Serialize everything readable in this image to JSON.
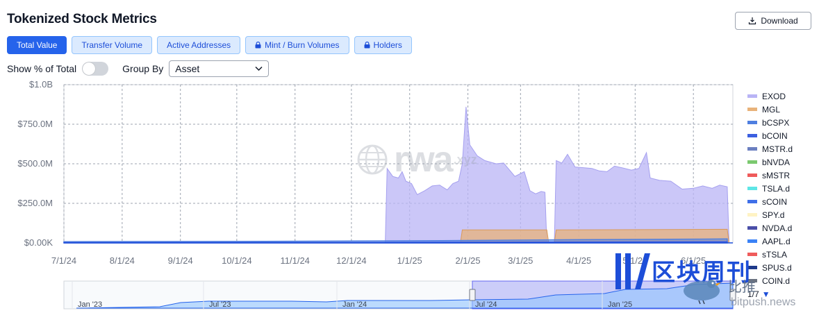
{
  "header": {
    "title": "Tokenized Stock Metrics",
    "download_label": "Download"
  },
  "tabs": [
    {
      "label": "Total Value",
      "active": true,
      "locked": false
    },
    {
      "label": "Transfer Volume",
      "active": false,
      "locked": false
    },
    {
      "label": "Active Addresses",
      "active": false,
      "locked": false
    },
    {
      "label": "Mint / Burn Volumes",
      "active": false,
      "locked": true
    },
    {
      "label": "Holders",
      "active": false,
      "locked": true
    }
  ],
  "controls": {
    "show_pct_label": "Show % of Total",
    "show_pct_enabled": false,
    "group_by_label": "Group By",
    "group_by_value": "Asset"
  },
  "legend": {
    "items": [
      {
        "name": "EXOD",
        "color": "#b9b4f5"
      },
      {
        "name": "MGL",
        "color": "#e8b27a"
      },
      {
        "name": "bCSPX",
        "color": "#4f7fe0"
      },
      {
        "name": "bCOIN",
        "color": "#3b5fe0"
      },
      {
        "name": "MSTR.d",
        "color": "#6b7fc0"
      },
      {
        "name": "bNVDA",
        "color": "#7bc96f"
      },
      {
        "name": "sMSTR",
        "color": "#ef5b5b"
      },
      {
        "name": "TSLA.d",
        "color": "#5ee6e6"
      },
      {
        "name": "sCOIN",
        "color": "#3f6fe8"
      },
      {
        "name": "SPY.d",
        "color": "#fff3c4"
      },
      {
        "name": "NVDA.d",
        "color": "#4a4fa8"
      },
      {
        "name": "AAPL.d",
        "color": "#3b82f6"
      },
      {
        "name": "sTSLA",
        "color": "#ef5b5b"
      },
      {
        "name": "SPUS.d",
        "color": "#1e3a8a"
      },
      {
        "name": "COIN.d",
        "color": "#6b7280"
      }
    ],
    "page": "1/7"
  },
  "watermark": {
    "logo_text": "rwa",
    "logo_suffix": ".xyz",
    "brand_cn": "区块周刊",
    "brand_cn_sub": "比推",
    "brand_url": "bitpush.news"
  },
  "chart_data": {
    "type": "area",
    "title": "",
    "xlabel": "",
    "ylabel": "",
    "ylim": [
      0,
      1000000000
    ],
    "y_ticks": [
      "$0.00K",
      "$250.0M",
      "$500.0M",
      "$750.0M",
      "$1.0B"
    ],
    "x_ticks": [
      "7/1/24",
      "8/1/24",
      "9/1/24",
      "10/1/24",
      "11/1/24",
      "12/1/24",
      "1/1/25",
      "2/1/25",
      "3/1/25",
      "4/1/25",
      "5/1/25",
      "6/1/25"
    ],
    "x_range": [
      "2024-07-01",
      "2025-06-22"
    ],
    "grid": true,
    "legend_position": "right",
    "series": [
      {
        "name": "EXOD",
        "color": "#b9b4f5",
        "points": [
          [
            "2024-12-19",
            0
          ],
          [
            "2024-12-20",
            470000000
          ],
          [
            "2024-12-23",
            420000000
          ],
          [
            "2024-12-26",
            410000000
          ],
          [
            "2024-12-28",
            450000000
          ],
          [
            "2024-12-30",
            390000000
          ],
          [
            "2025-01-02",
            375000000
          ],
          [
            "2025-01-05",
            305000000
          ],
          [
            "2025-01-09",
            330000000
          ],
          [
            "2025-01-13",
            360000000
          ],
          [
            "2025-01-17",
            365000000
          ],
          [
            "2025-01-21",
            335000000
          ],
          [
            "2025-01-24",
            375000000
          ],
          [
            "2025-01-27",
            390000000
          ],
          [
            "2025-01-29",
            500000000
          ],
          [
            "2025-01-31",
            860000000
          ],
          [
            "2025-02-02",
            620000000
          ],
          [
            "2025-02-06",
            550000000
          ],
          [
            "2025-02-10",
            520000000
          ],
          [
            "2025-02-16",
            500000000
          ],
          [
            "2025-02-20",
            505000000
          ],
          [
            "2025-02-26",
            420000000
          ],
          [
            "2025-03-03",
            450000000
          ],
          [
            "2025-03-06",
            330000000
          ],
          [
            "2025-03-09",
            310000000
          ],
          [
            "2025-03-12",
            325000000
          ],
          [
            "2025-03-14",
            320000000
          ],
          [
            "2025-03-15",
            0
          ],
          [
            "2025-03-19",
            0
          ],
          [
            "2025-03-20",
            520000000
          ],
          [
            "2025-03-23",
            505000000
          ],
          [
            "2025-03-26",
            560000000
          ],
          [
            "2025-03-30",
            480000000
          ],
          [
            "2025-04-04",
            475000000
          ],
          [
            "2025-04-08",
            470000000
          ],
          [
            "2025-04-12",
            455000000
          ],
          [
            "2025-04-16",
            450000000
          ],
          [
            "2025-04-20",
            485000000
          ],
          [
            "2025-04-24",
            475000000
          ],
          [
            "2025-04-29",
            460000000
          ],
          [
            "2025-05-03",
            470000000
          ],
          [
            "2025-05-07",
            570000000
          ],
          [
            "2025-05-09",
            410000000
          ],
          [
            "2025-05-14",
            395000000
          ],
          [
            "2025-05-20",
            390000000
          ],
          [
            "2025-05-26",
            340000000
          ],
          [
            "2025-06-01",
            345000000
          ],
          [
            "2025-06-06",
            360000000
          ],
          [
            "2025-06-11",
            345000000
          ],
          [
            "2025-06-15",
            365000000
          ],
          [
            "2025-06-19",
            355000000
          ],
          [
            "2025-06-20",
            0
          ]
        ]
      },
      {
        "name": "MGL",
        "color": "#e8b27a",
        "points": [
          [
            "2025-01-28",
            0
          ],
          [
            "2025-01-29",
            82000000
          ],
          [
            "2025-03-15",
            82000000
          ],
          [
            "2025-03-16",
            0
          ],
          [
            "2025-03-19",
            0
          ],
          [
            "2025-03-20",
            82000000
          ],
          [
            "2025-06-19",
            86000000
          ],
          [
            "2025-06-20",
            0
          ]
        ]
      },
      {
        "name": "bCSPX",
        "color": "#4f7fe0",
        "points": [
          [
            "2024-07-01",
            8000000
          ],
          [
            "2024-10-01",
            9000000
          ],
          [
            "2025-01-01",
            13000000
          ],
          [
            "2025-04-01",
            20000000
          ],
          [
            "2025-06-19",
            25000000
          ]
        ]
      },
      {
        "name": "bCOIN",
        "color": "#3b5fe0",
        "points": [
          [
            "2024-07-01",
            2000000
          ],
          [
            "2024-10-01",
            2500000
          ],
          [
            "2025-01-01",
            4000000
          ],
          [
            "2025-04-01",
            6000000
          ],
          [
            "2025-06-19",
            8000000
          ]
        ]
      }
    ]
  }
}
